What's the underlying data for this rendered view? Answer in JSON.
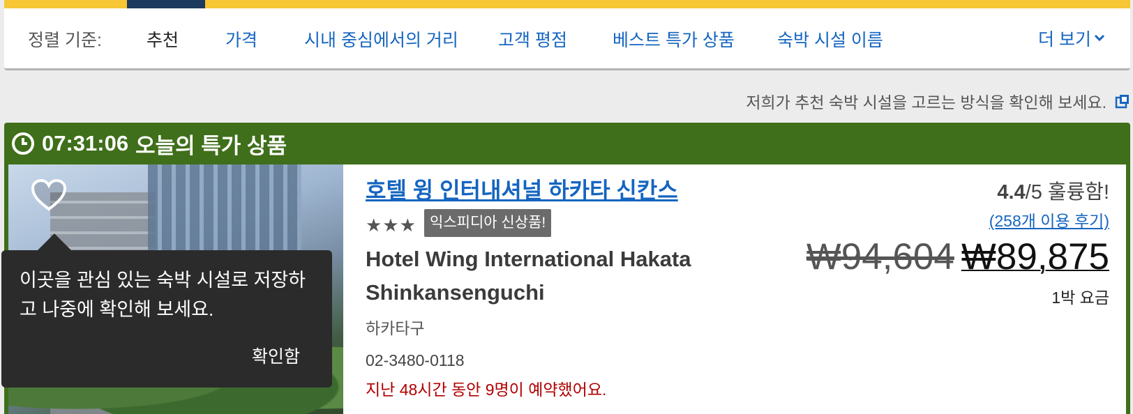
{
  "sort": {
    "label": "정렬 기준:",
    "tabs": [
      {
        "label": "추천"
      },
      {
        "label": "가격"
      },
      {
        "label": "시내 중심에서의 거리"
      },
      {
        "label": "고객 평점"
      },
      {
        "label": "베스트 특가 상품"
      },
      {
        "label": "숙박 시설 이름"
      }
    ],
    "more_label": "더 보기"
  },
  "info_text": "저희가 추천 숙박 시설을 고르는 방식을 확인해 보세요.",
  "deal": {
    "timer": "07:31:06",
    "title": "오늘의 특가 상품"
  },
  "tooltip": {
    "message": "이곳을 관심 있는 숙박 시설로 저장하고 나중에 확인해 보세요.",
    "confirm": "확인함"
  },
  "hotel": {
    "name_ko": "호텔 윙 인터내셔널 하카타 신칸스",
    "stars": "★★★",
    "badge": "익스피디아 신상품!",
    "name_en": "Hotel Wing International Hakata Shinkansenguchi",
    "area": "하카타구",
    "phone": "02-3480-0118",
    "booked_note": "지난 48시간 동안 9명이 예약했어요.",
    "rating_score": "4.4",
    "rating_rest": "/5 훌륭함!",
    "reviews": "(258개 이용 후기)",
    "old_price": "₩94,604",
    "new_price": "₩89,875",
    "per_night": "1박 요금"
  },
  "colors": {
    "accent_blue": "#1565c0",
    "deal_green": "#3f6f1a",
    "top_yellow": "#f6c634"
  }
}
